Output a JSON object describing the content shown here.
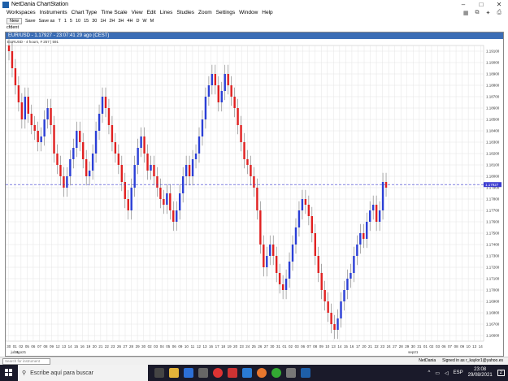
{
  "window": {
    "title": "NetDania ChartStation",
    "minimize": "–",
    "maximize": "□",
    "close": "✕"
  },
  "menu": [
    "Workspaces",
    "Instruments",
    "Chart Type",
    "Time Scale",
    "View",
    "Edit",
    "Lines",
    "Studies",
    "Zoom",
    "Settings",
    "Window",
    "Help"
  ],
  "toolbar": {
    "new": "New",
    "save": "Save",
    "save_as": "Save as",
    "timeframes": [
      "T",
      "1",
      "5",
      "10",
      "15",
      "30",
      "1H",
      "2H",
      "3H",
      "4H",
      "D",
      "W",
      "M"
    ]
  },
  "toolbar2": {
    "instrument": "cfdent"
  },
  "chart": {
    "header": "EUR/USD - 1.17927 - 23:07:41  29 ago (CEST)",
    "subheader": "EURUSD - 4 hours, # 257 | 591",
    "current_price": "1.17927",
    "x_ticks": [
      "30",
      "01",
      "02",
      "05",
      "06",
      "07",
      "08",
      "09",
      "12",
      "13",
      "14",
      "15",
      "16",
      "19",
      "20",
      "21",
      "22",
      "23",
      "26",
      "27",
      "28",
      "29",
      "30",
      "02",
      "03",
      "04",
      "05",
      "06",
      "09",
      "10",
      "11",
      "12",
      "13",
      "16",
      "17",
      "18",
      "19",
      "20",
      "23",
      "24",
      "25",
      "26",
      "27",
      "30",
      "31",
      "01",
      "02",
      "03",
      "06",
      "07",
      "08",
      "09",
      "10",
      "13",
      "14",
      "15",
      "16",
      "17",
      "20",
      "21",
      "22",
      "23",
      "24",
      "27",
      "28",
      "29",
      "30",
      "31",
      "01",
      "02",
      "03",
      "06",
      "07",
      "08",
      "09",
      "10",
      "13",
      "14"
    ],
    "month_labels": [
      {
        "label": "jul21",
        "tick": "01"
      },
      {
        "label": "ago21",
        "tick": "02"
      },
      {
        "label": "sep21",
        "tick": "30"
      }
    ]
  },
  "chart_data": {
    "type": "candlestick",
    "y_ticks": [
      "1.19100",
      "1.19000",
      "1.18900",
      "1.18800",
      "1.18700",
      "1.18600",
      "1.18500",
      "1.18400",
      "1.18300",
      "1.18200",
      "1.18100",
      "1.18000",
      "1.17900",
      "1.17800",
      "1.17700",
      "1.17600",
      "1.17500",
      "1.17400",
      "1.17300",
      "1.17200",
      "1.17100",
      "1.17000",
      "1.16900",
      "1.16800",
      "1.16700",
      "1.16600"
    ],
    "y_range": [
      1.1655,
      1.1915
    ],
    "last_price": 1.17927,
    "closes": [
      1.191,
      1.1895,
      1.188,
      1.1865,
      1.185,
      1.187,
      1.1855,
      1.1845,
      1.184,
      1.183,
      1.1835,
      1.185,
      1.186,
      1.1845,
      1.182,
      1.181,
      1.18,
      1.179,
      1.18,
      1.1815,
      1.1825,
      1.184,
      1.183,
      1.1815,
      1.18,
      1.1805,
      1.182,
      1.184,
      1.1855,
      1.187,
      1.186,
      1.1845,
      1.183,
      1.182,
      1.181,
      1.1795,
      1.178,
      1.177,
      1.179,
      1.181,
      1.1825,
      1.1835,
      1.182,
      1.1805,
      1.181,
      1.18,
      1.179,
      1.178,
      1.1775,
      1.1785,
      1.177,
      1.176,
      1.177,
      1.1785,
      1.18,
      1.181,
      1.18,
      1.1815,
      1.182,
      1.1835,
      1.185,
      1.187,
      1.188,
      1.189,
      1.188,
      1.1865,
      1.1875,
      1.189,
      1.188,
      1.187,
      1.186,
      1.1845,
      1.183,
      1.1815,
      1.181,
      1.18,
      1.179,
      1.177,
      1.174,
      1.172,
      1.173,
      1.174,
      1.173,
      1.1715,
      1.1705,
      1.17,
      1.171,
      1.1725,
      1.174,
      1.1755,
      1.177,
      1.178,
      1.1775,
      1.1765,
      1.175,
      1.173,
      1.1715,
      1.17,
      1.169,
      1.168,
      1.167,
      1.1665,
      1.1675,
      1.169,
      1.17,
      1.171,
      1.1715,
      1.173,
      1.174,
      1.175,
      1.1745,
      1.176,
      1.177,
      1.1775,
      1.176,
      1.177,
      1.1795,
      1.179
    ]
  },
  "statusbar": {
    "search_placeholder": "Search for instrument",
    "brand": "NetDania",
    "user": "Signed in as r_kaylor1@yahoo.es"
  },
  "taskbar": {
    "search_placeholder": "Escribe aquí para buscar",
    "time": "23:08",
    "date": "29/08/2021",
    "notif_count": "2"
  }
}
